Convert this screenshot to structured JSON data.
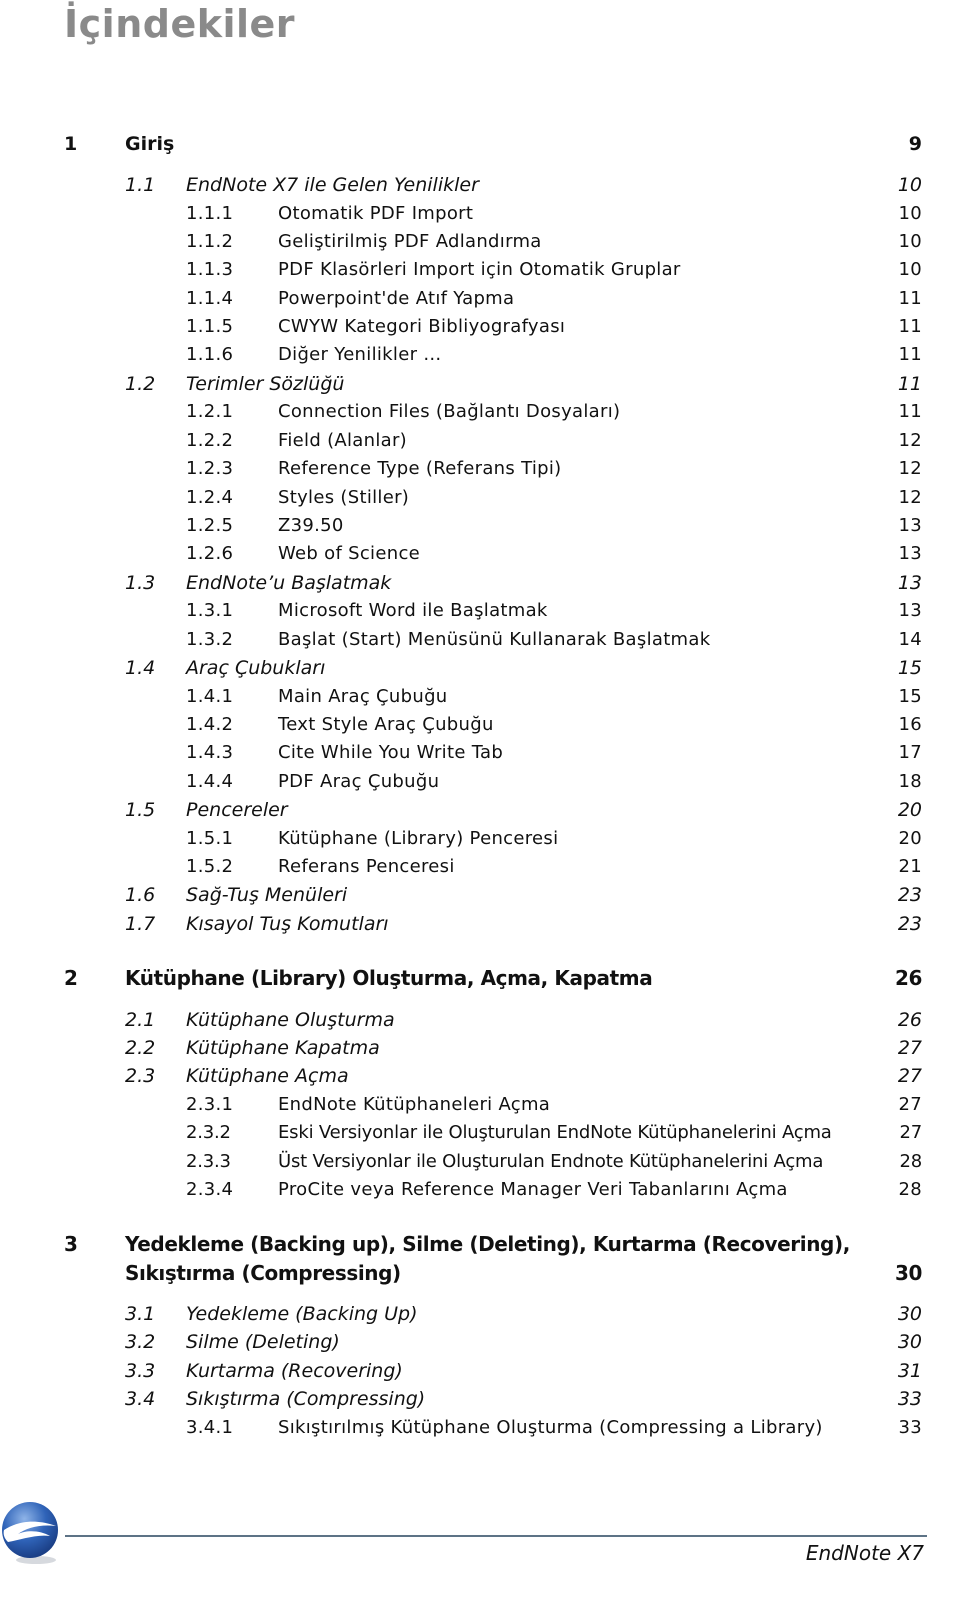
{
  "document": {
    "title": "İçindekiler",
    "footer_text": "EndNote X7",
    "accent_color": "#5d7386",
    "title_color": "#8a8a8a"
  },
  "toc": [
    {
      "level": 1,
      "number": "1",
      "label": "Giriş",
      "page": "9"
    },
    {
      "level": 2,
      "number": "1.1",
      "label": "EndNote X7 ile Gelen Yenilikler",
      "page": "10"
    },
    {
      "level": 3,
      "number": "1.1.1",
      "label": "Otomatik PDF Import",
      "page": "10"
    },
    {
      "level": 3,
      "number": "1.1.2",
      "label": "Geliştirilmiş PDF Adlandırma",
      "page": "10"
    },
    {
      "level": 3,
      "number": "1.1.3",
      "label": "PDF Klasörleri Import için Otomatik Gruplar",
      "page": "10"
    },
    {
      "level": 3,
      "number": "1.1.4",
      "label": "Powerpoint'de Atıf Yapma",
      "page": "11"
    },
    {
      "level": 3,
      "number": "1.1.5",
      "label": "CWYW Kategori Bibliyografyası",
      "page": "11"
    },
    {
      "level": 3,
      "number": "1.1.6",
      "label": "Diğer Yenilikler …",
      "page": "11"
    },
    {
      "level": 2,
      "number": "1.2",
      "label": "Terimler Sözlüğü",
      "page": "11"
    },
    {
      "level": 3,
      "number": "1.2.1",
      "label": "Connection Files (Bağlantı Dosyaları)",
      "page": "11"
    },
    {
      "level": 3,
      "number": "1.2.2",
      "label": "Field (Alanlar)",
      "page": "12"
    },
    {
      "level": 3,
      "number": "1.2.3",
      "label": "Reference Type (Referans Tipi)",
      "page": "12"
    },
    {
      "level": 3,
      "number": "1.2.4",
      "label": "Styles (Stiller)",
      "page": "12"
    },
    {
      "level": 3,
      "number": "1.2.5",
      "label": "Z39.50",
      "page": "13"
    },
    {
      "level": 3,
      "number": "1.2.6",
      "label": "Web of Science",
      "page": "13"
    },
    {
      "level": 2,
      "number": "1.3",
      "label": "EndNote’u Başlatmak",
      "page": "13"
    },
    {
      "level": 3,
      "number": "1.3.1",
      "label": "Microsoft Word ile Başlatmak",
      "page": "13"
    },
    {
      "level": 3,
      "number": "1.3.2",
      "label": "Başlat (Start) Menüsünü Kullanarak Başlatmak",
      "page": "14"
    },
    {
      "level": 2,
      "number": "1.4",
      "label": "Araç Çubukları",
      "page": "15"
    },
    {
      "level": 3,
      "number": "1.4.1",
      "label": "Main Araç Çubuğu",
      "page": "15"
    },
    {
      "level": 3,
      "number": "1.4.2",
      "label": "Text Style Araç Çubuğu",
      "page": "16"
    },
    {
      "level": 3,
      "number": "1.4.3",
      "label": "Cite While You Write Tab",
      "page": "17"
    },
    {
      "level": 3,
      "number": "1.4.4",
      "label": "PDF Araç Çubuğu",
      "page": "18"
    },
    {
      "level": 2,
      "number": "1.5",
      "label": "Pencereler",
      "page": "20"
    },
    {
      "level": 3,
      "number": "1.5.1",
      "label": "Kütüphane (Library) Penceresi",
      "page": "20"
    },
    {
      "level": 3,
      "number": "1.5.2",
      "label": "Referans Penceresi",
      "page": "21"
    },
    {
      "level": 2,
      "number": "1.6",
      "label": "Sağ-Tuş Menüleri",
      "page": "23"
    },
    {
      "level": 2,
      "number": "1.7",
      "label": "Kısayol Tuş Komutları",
      "page": "23"
    },
    {
      "level": 1,
      "number": "2",
      "label": "Kütüphane (Library) Oluşturma, Açma, Kapatma",
      "page": "26"
    },
    {
      "level": 2,
      "number": "2.1",
      "label": "Kütüphane Oluşturma",
      "page": "26"
    },
    {
      "level": 2,
      "number": "2.2",
      "label": "Kütüphane Kapatma",
      "page": "27"
    },
    {
      "level": 2,
      "number": "2.3",
      "label": "Kütüphane Açma",
      "page": "27"
    },
    {
      "level": 3,
      "number": "2.3.1",
      "label": "EndNote Kütüphaneleri Açma",
      "page": "27"
    },
    {
      "level": 3,
      "number": "2.3.2",
      "label": "Eski Versiyonlar ile Oluşturulan EndNote Kütüphanelerini Açma",
      "page": "27"
    },
    {
      "level": 3,
      "number": "2.3.3",
      "label": "Üst Versiyonlar ile Oluşturulan Endnote Kütüphanelerini Açma",
      "page": "28"
    },
    {
      "level": 3,
      "number": "2.3.4",
      "label": "ProCite veya Reference Manager Veri Tabanlarını Açma",
      "page": "28"
    },
    {
      "level": 1,
      "number": "3",
      "label": "Yedekleme (Backing up), Silme (Deleting), Kurtarma (Recovering),",
      "label_line2": "Sıkıştırma (Compressing)",
      "page": "30"
    },
    {
      "level": 2,
      "number": "3.1",
      "label": "Yedekleme (Backing Up)",
      "page": "30"
    },
    {
      "level": 2,
      "number": "3.2",
      "label": "Silme (Deleting)",
      "page": "30"
    },
    {
      "level": 2,
      "number": "3.3",
      "label": "Kurtarma (Recovering)",
      "page": "31"
    },
    {
      "level": 2,
      "number": "3.4",
      "label": "Sıkıştırma (Compressing)",
      "page": "33"
    },
    {
      "level": 3,
      "number": "3.4.1",
      "label": "Sıkıştırılmış Kütüphane Oluşturma (Compressing a Library)",
      "page": "33"
    }
  ]
}
